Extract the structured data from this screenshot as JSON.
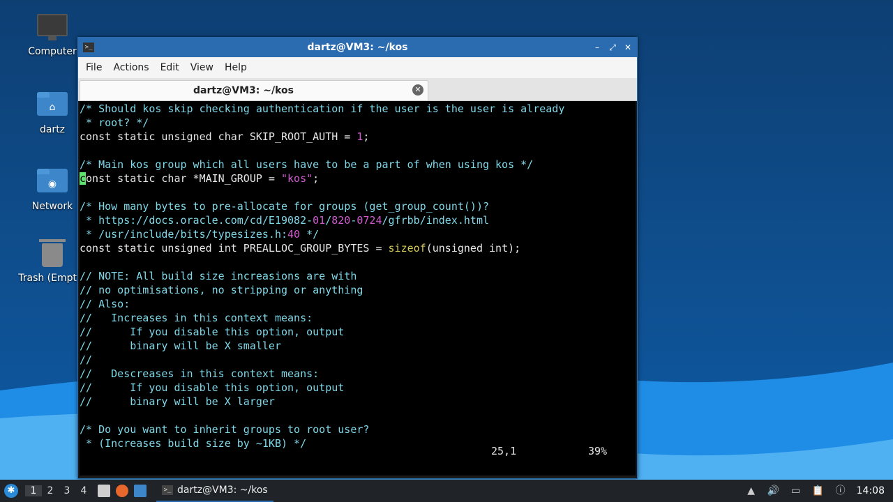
{
  "desktop": {
    "icons": [
      {
        "label": "Computer",
        "icon": "computer-icon"
      },
      {
        "label": "dartz",
        "icon": "home-folder-icon"
      },
      {
        "label": "Network",
        "icon": "network-folder-icon"
      },
      {
        "label": "Trash (Empty)",
        "icon": "trash-icon"
      }
    ]
  },
  "window": {
    "title": "dartz@VM3: ~/kos",
    "menu": [
      "File",
      "Actions",
      "Edit",
      "View",
      "Help"
    ],
    "tab_label": "dartz@VM3: ~/kos"
  },
  "terminal": {
    "lines": [
      [
        {
          "t": "/* Should kos skip checking authentication if the user is the user is already",
          "c": "comment"
        }
      ],
      [
        {
          "t": " * root? */",
          "c": "comment"
        }
      ],
      [
        {
          "t": "const static unsigned char SKIP_ROOT_AUTH = ",
          "c": ""
        },
        {
          "t": "1",
          "c": "num"
        },
        {
          "t": ";",
          "c": ""
        }
      ],
      [
        {
          "t": "",
          "c": ""
        }
      ],
      [
        {
          "t": "/* Main kos group which all users have to be a part of when using kos */",
          "c": "comment"
        }
      ],
      [
        {
          "t": "c",
          "c": "cursor"
        },
        {
          "t": "onst static char *MAIN_GROUP = ",
          "c": ""
        },
        {
          "t": "\"kos\"",
          "c": "str"
        },
        {
          "t": ";",
          "c": ""
        }
      ],
      [
        {
          "t": "",
          "c": ""
        }
      ],
      [
        {
          "t": "/* How many bytes to pre-allocate for groups (get_group_count())?",
          "c": "comment"
        }
      ],
      [
        {
          "t": " * https://docs.oracle.com/cd/E19082-",
          "c": "comment"
        },
        {
          "t": "01",
          "c": "num"
        },
        {
          "t": "/",
          "c": "comment"
        },
        {
          "t": "820",
          "c": "num"
        },
        {
          "t": "-",
          "c": "comment"
        },
        {
          "t": "0724",
          "c": "num"
        },
        {
          "t": "/gfrbb/index.html",
          "c": "comment"
        }
      ],
      [
        {
          "t": " * /usr/include/bits/typesizes.h:",
          "c": "comment"
        },
        {
          "t": "40",
          "c": "num"
        },
        {
          "t": " */",
          "c": "comment"
        }
      ],
      [
        {
          "t": "const static unsigned int PREALLOC_GROUP_BYTES = ",
          "c": ""
        },
        {
          "t": "sizeof",
          "c": "func"
        },
        {
          "t": "(unsigned int);",
          "c": ""
        }
      ],
      [
        {
          "t": "",
          "c": ""
        }
      ],
      [
        {
          "t": "// NOTE: All build size increasions are with",
          "c": "comment"
        }
      ],
      [
        {
          "t": "// no optimisations, no stripping or anything",
          "c": "comment"
        }
      ],
      [
        {
          "t": "// Also:",
          "c": "comment"
        }
      ],
      [
        {
          "t": "//   Increases in this context means:",
          "c": "comment"
        }
      ],
      [
        {
          "t": "//      If you disable this option, output",
          "c": "comment"
        }
      ],
      [
        {
          "t": "//      binary will be X smaller",
          "c": "comment"
        }
      ],
      [
        {
          "t": "//",
          "c": "comment"
        }
      ],
      [
        {
          "t": "//   Descreases in this context means:",
          "c": "comment"
        }
      ],
      [
        {
          "t": "//      If you disable this option, output",
          "c": "comment"
        }
      ],
      [
        {
          "t": "//      binary will be X larger",
          "c": "comment"
        }
      ],
      [
        {
          "t": "",
          "c": ""
        }
      ],
      [
        {
          "t": "/* Do you want to inherit groups to root user?",
          "c": "comment"
        }
      ],
      [
        {
          "t": " * (Increases build size by ~1KB) */",
          "c": "comment"
        }
      ]
    ],
    "status_position": "25,1",
    "status_percent": "39%"
  },
  "taskbar": {
    "workspaces": [
      "1",
      "2",
      "3",
      "4"
    ],
    "active_workspace": "1",
    "task_label": "dartz@VM3: ~/kos",
    "clock": "14:08"
  }
}
